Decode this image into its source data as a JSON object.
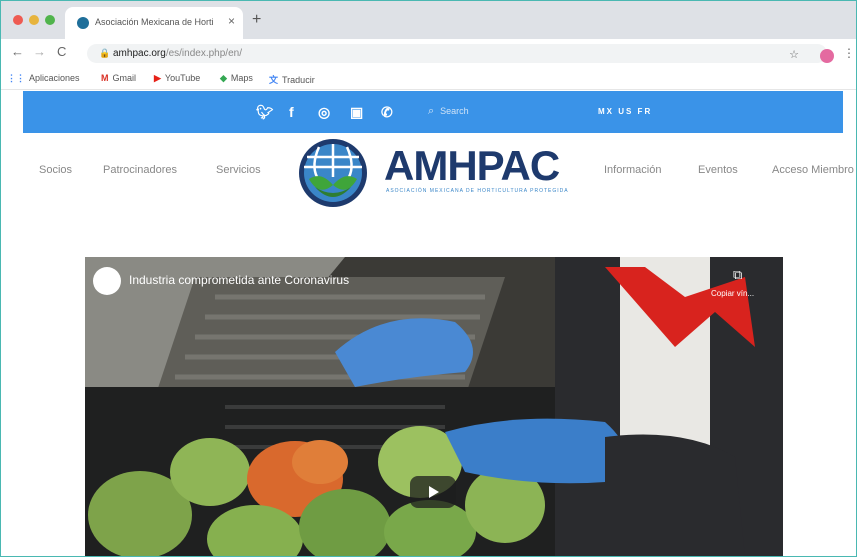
{
  "browser": {
    "tab_title": "Asociación Mexicana de Horti",
    "tab_close": "×",
    "new_tab": "+",
    "url_host": "amhpac.org",
    "url_path": "/es/index.php/en/",
    "back": "←",
    "forward": "→",
    "reload": "C",
    "star": "☆",
    "menu": "⋮",
    "lock": "🔒"
  },
  "bookmarks": {
    "apps": "Aplicaciones",
    "gmail": "Gmail",
    "youtube": "YouTube",
    "maps": "Maps",
    "translate": "Traducir"
  },
  "site": {
    "search_placeholder": "Search",
    "flags": "MX  US  FR",
    "nav_left": [
      "Socios",
      "Patrocinadores",
      "Servicios"
    ],
    "nav_right": [
      "Información",
      "Eventos",
      "Acceso Miembro"
    ],
    "logo_text": "AMHPAC",
    "logo_tagline": "ASOCIACIÓN MEXICANA DE HORTICULTURA PROTEGIDA"
  },
  "video": {
    "title": "Industria comprometida ante Coronavirus",
    "copy_label": "Copiar vín...",
    "copy_icon": "⧉"
  },
  "colors": {
    "site_bar": "#3a93e8",
    "logo_navy": "#1e3a6d",
    "frame_border": "#4ab8b2"
  }
}
